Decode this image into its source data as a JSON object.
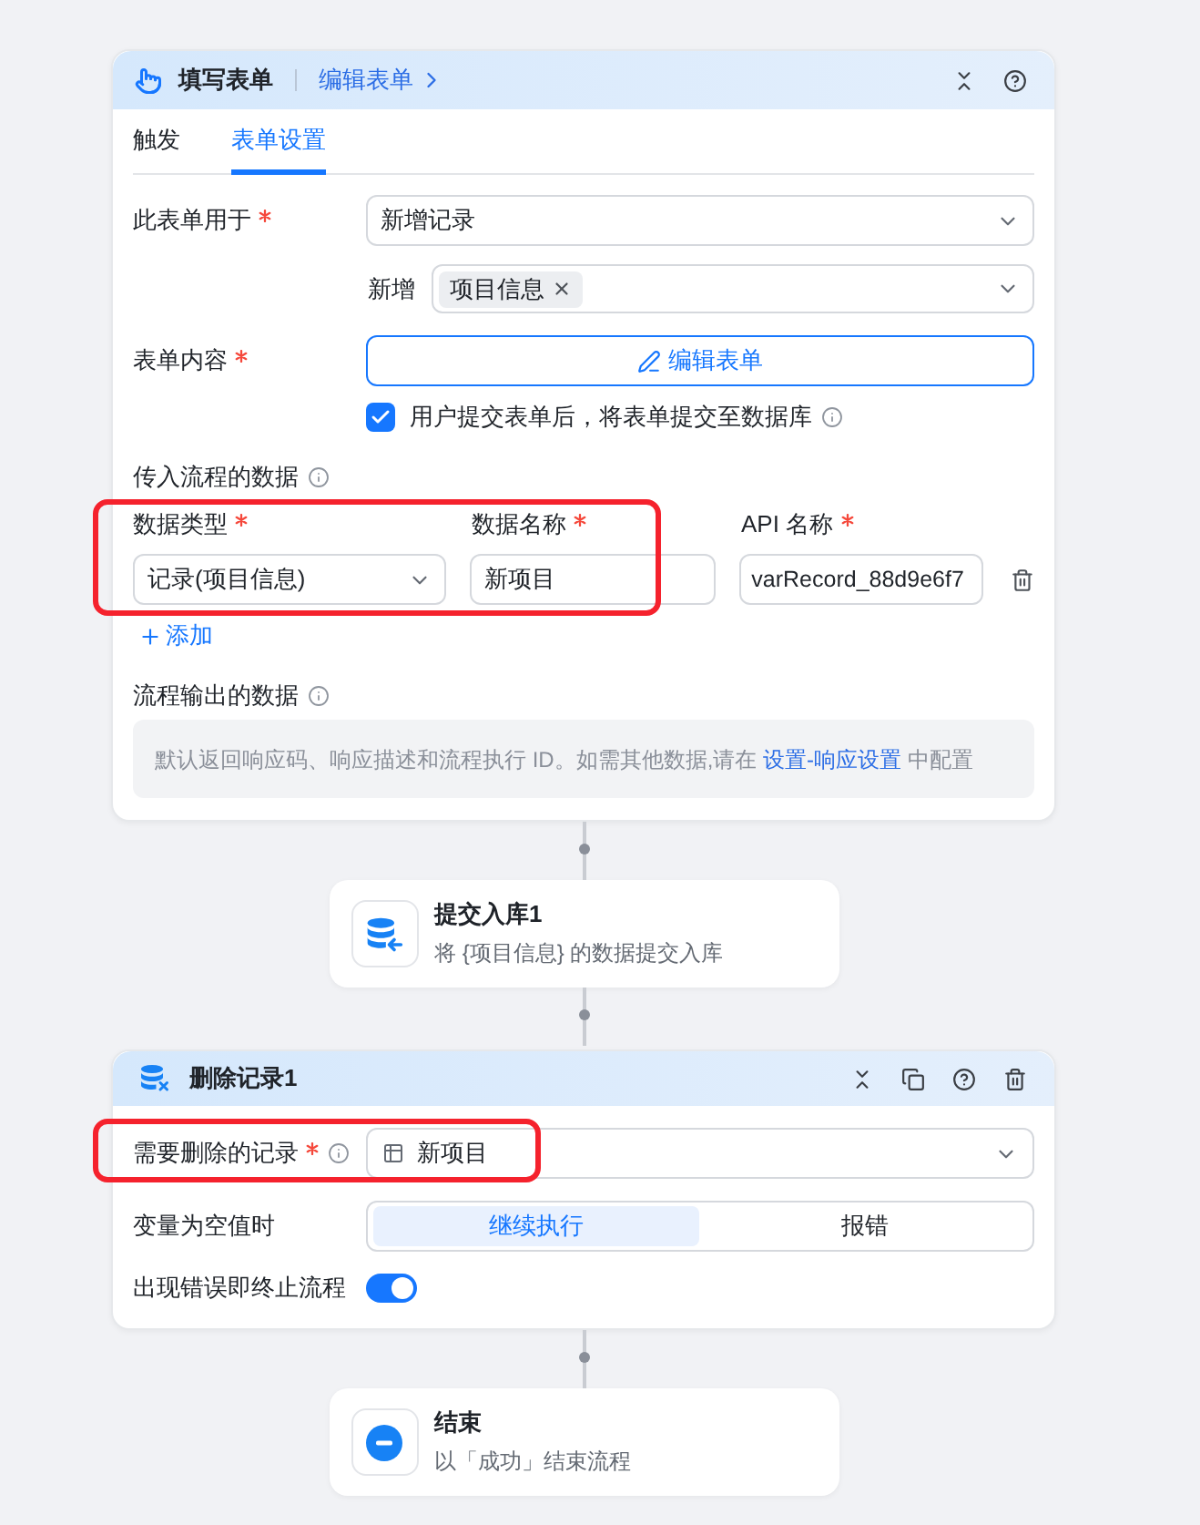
{
  "form_card": {
    "title": "填写表单",
    "edit_link": "编辑表单",
    "tabs": [
      {
        "label": "触发",
        "selected": false
      },
      {
        "label": "表单设置",
        "selected": true
      }
    ],
    "usage": {
      "label": "此表单用于",
      "required": true,
      "value": "新增记录"
    },
    "add_target": {
      "label": "新增",
      "tags": [
        "项目信息"
      ]
    },
    "content": {
      "label": "表单内容",
      "required": true,
      "button": "编辑表单"
    },
    "submit_to_db": {
      "label": "用户提交表单后，将表单提交至数据库",
      "checked": true
    },
    "input_data": {
      "title": "传入流程的数据",
      "highlighted": true,
      "columns": [
        {
          "label": "数据类型",
          "required": true
        },
        {
          "label": "数据名称",
          "required": true
        },
        {
          "label": "API 名称",
          "required": true
        }
      ],
      "rows": [
        {
          "type": "记录(项目信息)",
          "name": "新项目",
          "api_name": "varRecord_88d9e6f7"
        }
      ],
      "add_button": "添加"
    },
    "output_data": {
      "title": "流程输出的数据",
      "note": "默认返回响应码、响应描述和流程执行 ID。如需其他数据,请在",
      "note_link": "设置-响应设置",
      "note_end": "中配置"
    }
  },
  "submit_node": {
    "title": "提交入库1",
    "description": "将 {项目信息} 的数据提交入库"
  },
  "delete_card": {
    "title": "删除记录1",
    "record": {
      "label": "需要删除的记录",
      "required": true,
      "value": "新项目",
      "highlighted": true
    },
    "empty_value": {
      "label": "变量为空值时",
      "options": [
        {
          "label": "继续执行",
          "selected": true
        },
        {
          "label": "报错",
          "selected": false
        }
      ]
    },
    "stop_on_error": {
      "label": "出现错误即终止流程",
      "on": true
    }
  },
  "end_node": {
    "title": "结束",
    "description": "以「成功」结束流程"
  }
}
